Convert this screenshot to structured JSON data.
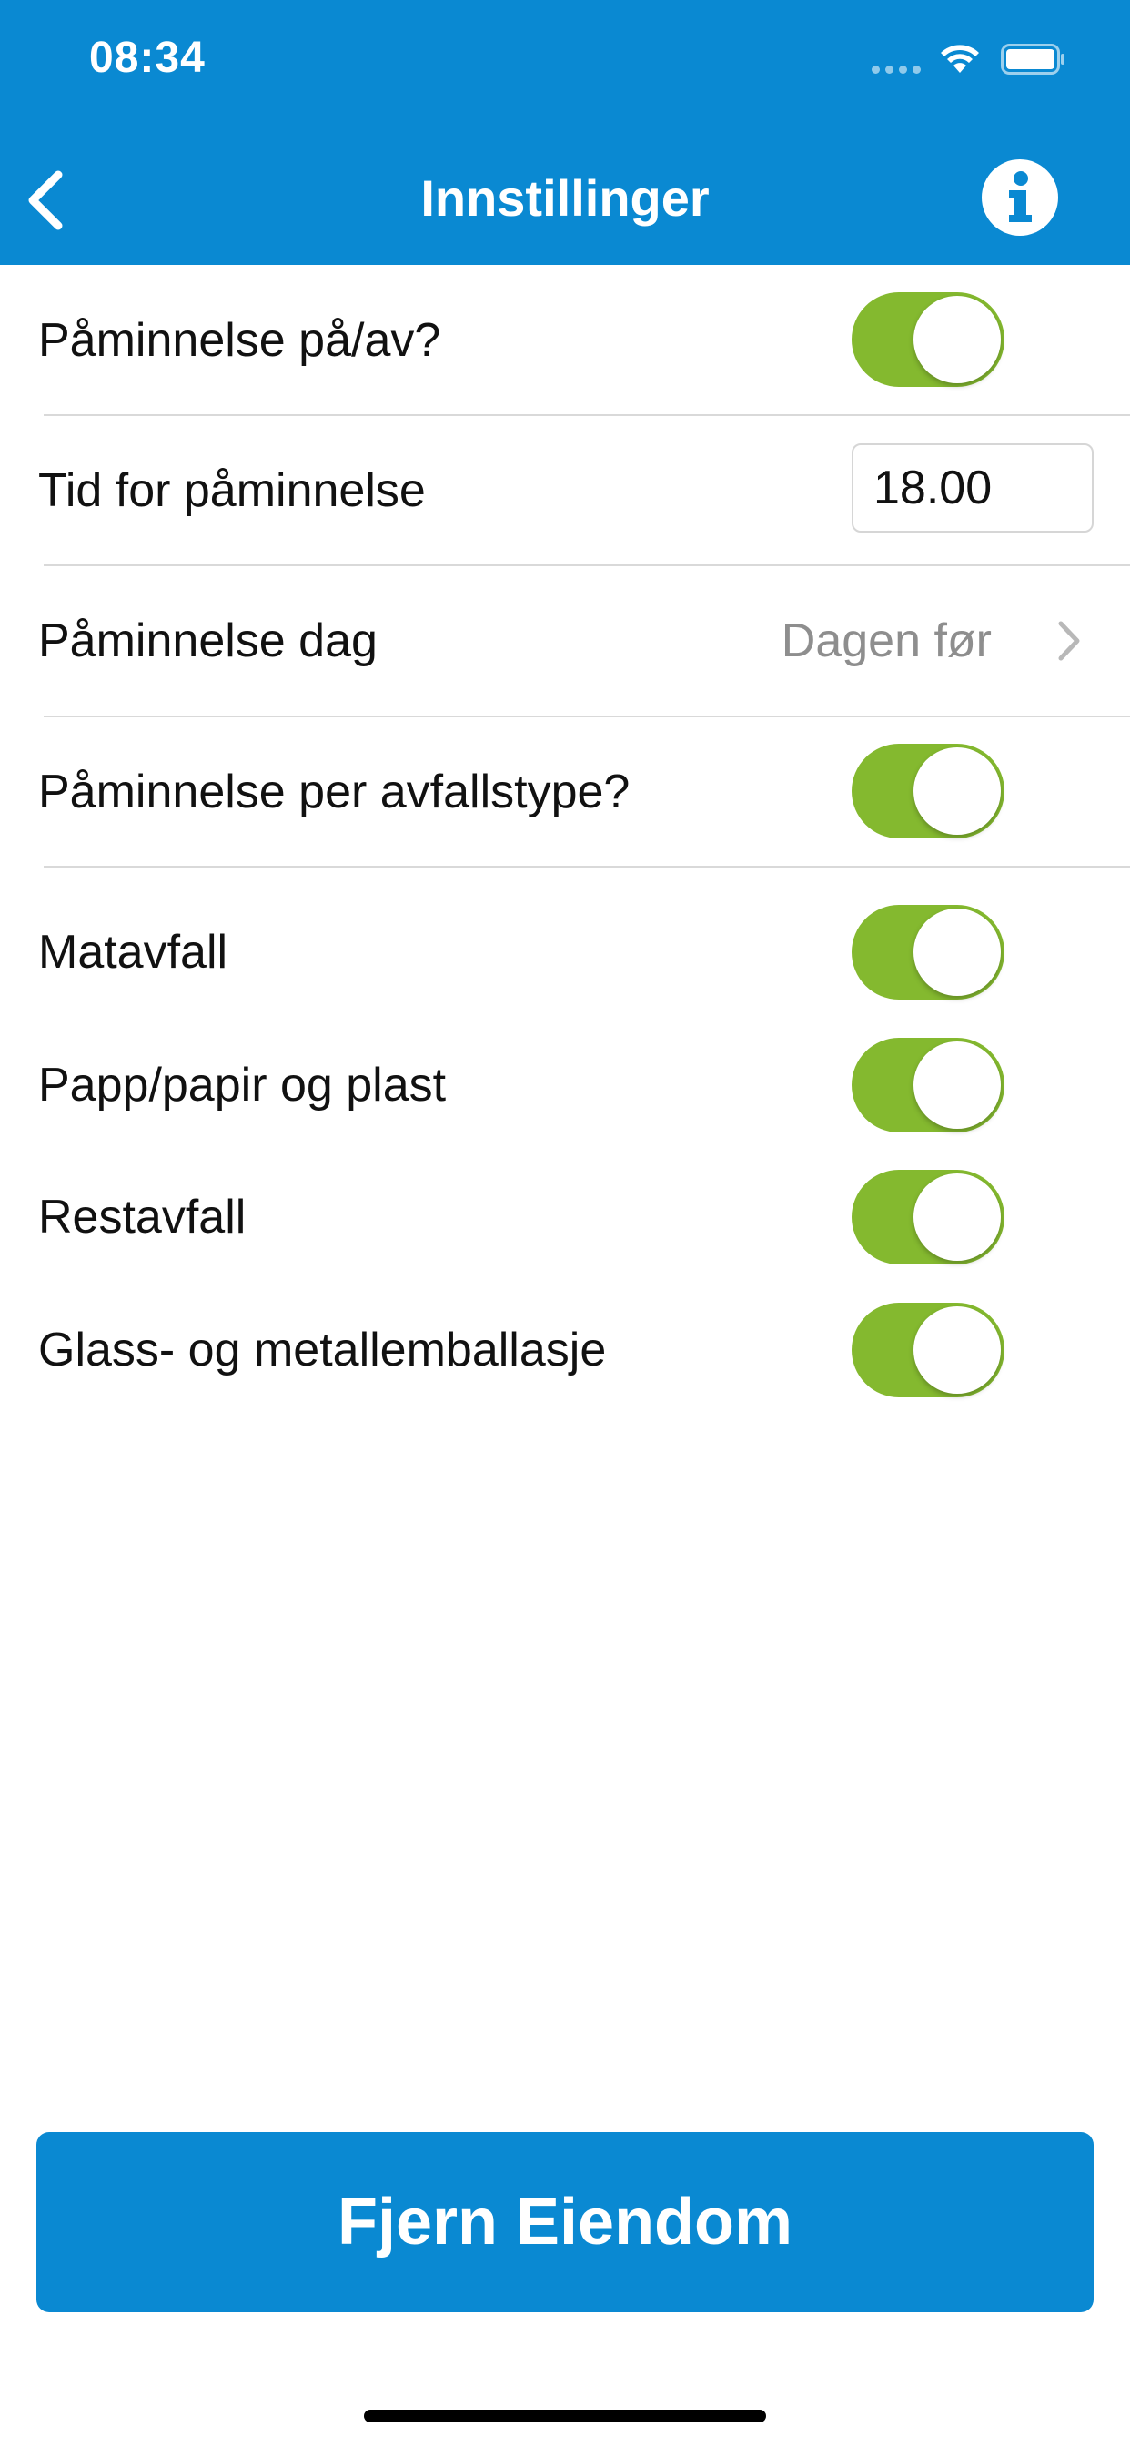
{
  "status_bar": {
    "time": "08:34"
  },
  "nav": {
    "title": "Innstillinger",
    "back_icon": "chevron-left-icon",
    "info_icon": "info-icon"
  },
  "settings": {
    "reminder_toggle": {
      "label": "Påminnelse på/av?",
      "on": true
    },
    "reminder_time": {
      "label": "Tid for påminnelse",
      "value": "18.00"
    },
    "reminder_day": {
      "label": "Påminnelse dag",
      "value": "Dagen før"
    },
    "per_type_toggle": {
      "label": "Påminnelse per avfallstype?",
      "on": true
    },
    "waste_types": [
      {
        "label": "Matavfall",
        "on": true
      },
      {
        "label": "Papp/papir og plast",
        "on": true
      },
      {
        "label": "Restavfall",
        "on": true
      },
      {
        "label": "Glass- og metallemballasje",
        "on": true
      }
    ]
  },
  "actions": {
    "remove_property": "Fjern Eiendom"
  },
  "colors": {
    "brand_blue": "#0a89d2",
    "toggle_green": "#84b92f"
  }
}
